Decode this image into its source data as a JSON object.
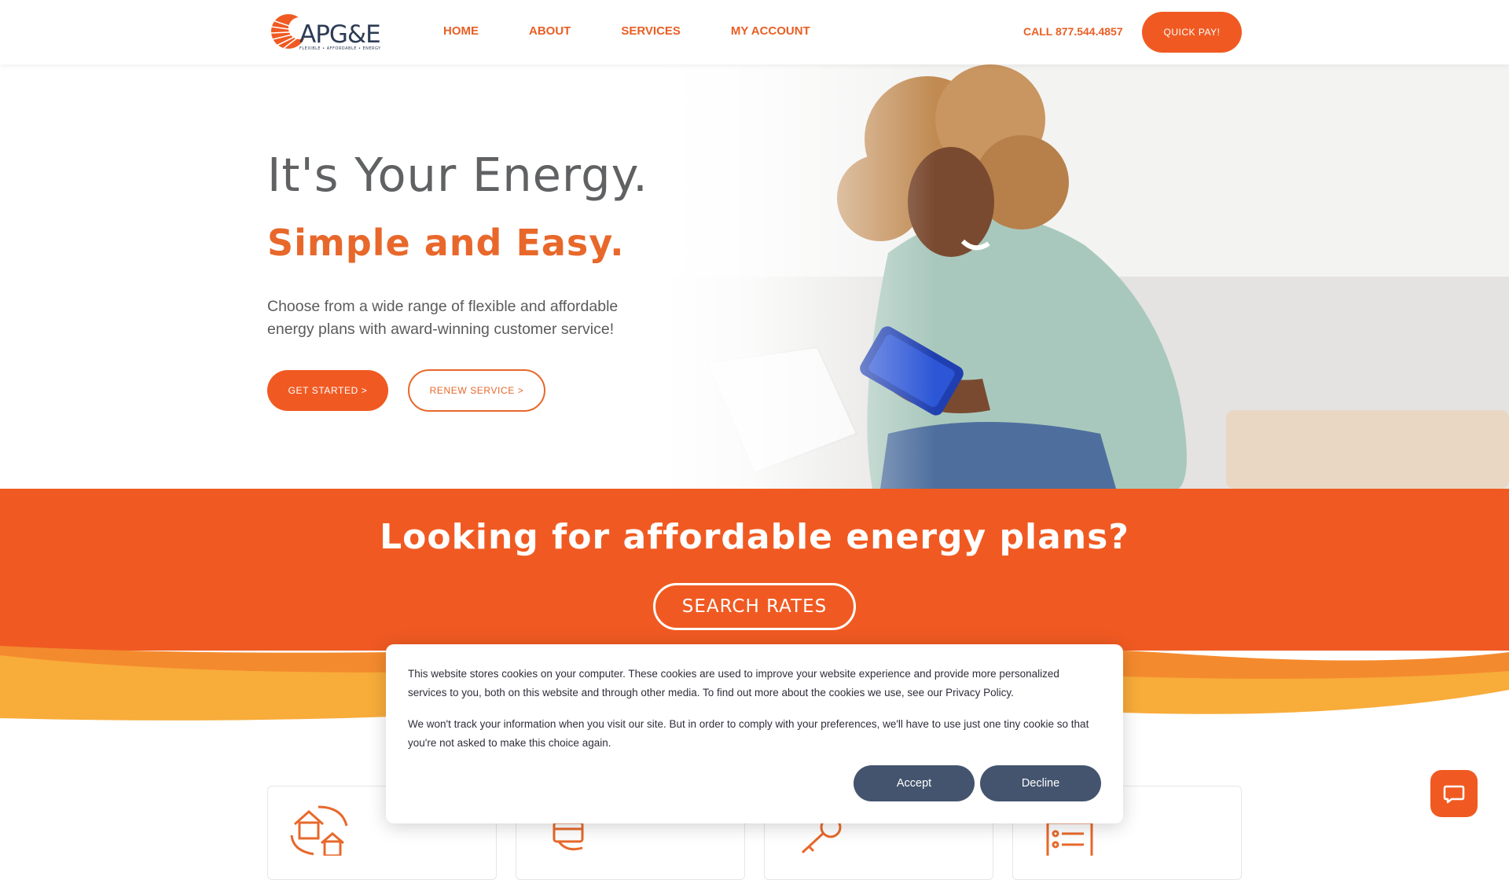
{
  "header": {
    "logo_text": "APG&E",
    "logo_tagline": "FLEXIBLE • AFFORDABLE • ENERGY",
    "nav": [
      "HOME",
      "ABOUT",
      "SERVICES",
      "MY ACCOUNT"
    ],
    "call": "CALL 877.544.4857",
    "quick_pay": "QUICK PAY!"
  },
  "hero": {
    "title": "It's Your Energy.",
    "subtitle": "Simple and Easy.",
    "body": "Choose from a wide range of flexible and affordable energy plans with award-winning customer service!",
    "get_started": "GET STARTED >",
    "renew_service": "RENEW SERVICE >"
  },
  "band": {
    "title": "Looking for affordable energy plans?",
    "search_rates": "SEARCH RATES"
  },
  "feature_icons": [
    "home-cycle-icon",
    "hand-card-icon",
    "key-icon",
    "checklist-icon"
  ],
  "cookie": {
    "text1": "This website stores cookies on your computer. These cookies are used to improve your website experience and provide more personalized services to you, both on this website and through other media. To find out more about the cookies we use, see our Privacy Policy.",
    "text2": "We won't track your information when you visit our site. But in order to comply with your preferences, we'll have to use just one tiny cookie so that you're not asked to make this choice again.",
    "accept": "Accept",
    "decline": "Decline"
  },
  "colors": {
    "brand_orange": "#f05a22",
    "wave_yellow": "#f8ac3a",
    "wave_mid": "#f48a2e",
    "navy": "#2d3b55",
    "button_slate": "#44546e"
  }
}
